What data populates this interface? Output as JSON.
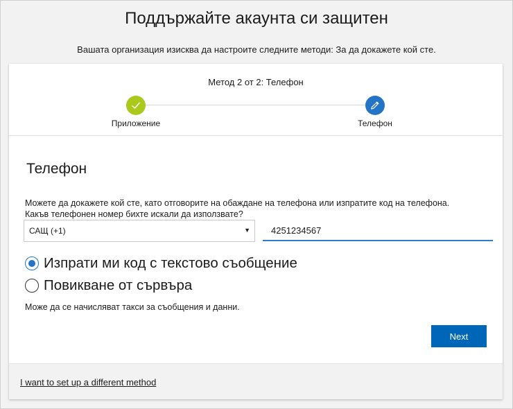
{
  "header": {
    "title": "Поддържайте акаунта си защитен",
    "subtitle": "Вашата организация изисква да настроите следните методи: За да докажете кой сте."
  },
  "stepper": {
    "caption": "Метод 2 от 2: Телефон",
    "steps": [
      {
        "label": "Приложение",
        "state": "done",
        "icon": "checkmark-icon"
      },
      {
        "label": "Телефон",
        "state": "current",
        "icon": "pencil-icon"
      }
    ],
    "colors": {
      "done": "#a9c91c",
      "current": "#2374c6"
    }
  },
  "phone": {
    "title": "Телефон",
    "description": "Можете да докажете кой сте, като отговорите на обаждане на телефона или изпратите код на телефона.",
    "question": "Какъв телефонен номер бихте искали да използвате?",
    "country": "САЩ (+1)",
    "number": "4251234567",
    "options": [
      {
        "label": "Изпрати ми код с текстово съобщение",
        "selected": true
      },
      {
        "label": "Повикване от сървъра",
        "selected": false
      }
    ],
    "fees_note": "Може да се начисляват такси за съобщения и данни."
  },
  "actions": {
    "next_label": "Next",
    "accent": "#0067b8"
  },
  "footer": {
    "link": "I want to set up a different method"
  }
}
